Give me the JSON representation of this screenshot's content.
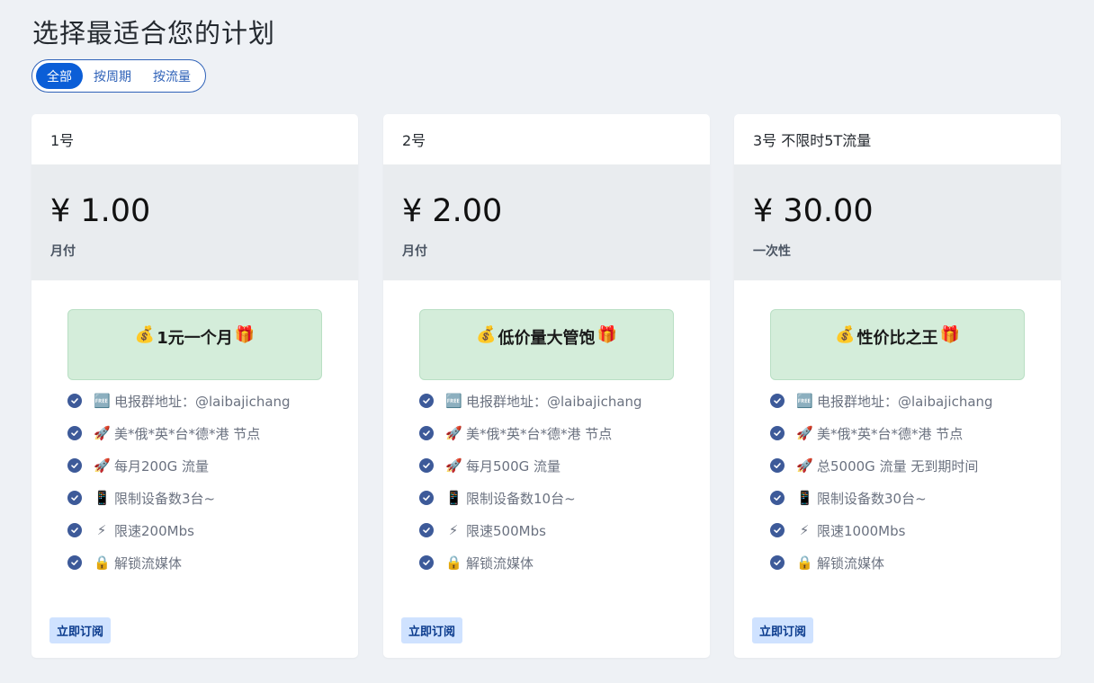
{
  "page": {
    "title": "选择最适合您的计划"
  },
  "filters": [
    {
      "label": "全部",
      "active": true
    },
    {
      "label": "按周期",
      "active": false
    },
    {
      "label": "按流量",
      "active": false
    }
  ],
  "colors": {
    "accent": "#0b5ed7",
    "promo_bg": "#d4edda",
    "price_bg": "#e9ecef",
    "check": "#3d5a99"
  },
  "plans": [
    {
      "name": "1号",
      "price": "¥ 1.00",
      "period": "月付",
      "promo": "1元一个月",
      "features": [
        {
          "icon": "free-icon",
          "glyph": "🆓",
          "text": "电报群地址：@laibajichang"
        },
        {
          "icon": "rocket-icon",
          "glyph": "🚀",
          "text": "美*俄*英*台*德*港 节点"
        },
        {
          "icon": "rocket-icon",
          "glyph": "🚀",
          "text": "每月200G 流量"
        },
        {
          "icon": "phone-icon",
          "glyph": "📱",
          "text": "限制设备数3台~"
        },
        {
          "icon": "lightning-icon",
          "glyph": "⚡",
          "text": "限速200Mbs"
        },
        {
          "icon": "lock-icon",
          "glyph": "🔒",
          "text": "解锁流媒体"
        }
      ],
      "cta": "立即订阅"
    },
    {
      "name": "2号",
      "price": "¥ 2.00",
      "period": "月付",
      "promo": "低价量大管饱",
      "features": [
        {
          "icon": "free-icon",
          "glyph": "🆓",
          "text": "电报群地址：@laibajichang"
        },
        {
          "icon": "rocket-icon",
          "glyph": "🚀",
          "text": "美*俄*英*台*德*港 节点"
        },
        {
          "icon": "rocket-icon",
          "glyph": "🚀",
          "text": "每月500G 流量"
        },
        {
          "icon": "phone-icon",
          "glyph": "📱",
          "text": "限制设备数10台~"
        },
        {
          "icon": "lightning-icon",
          "glyph": "⚡",
          "text": "限速500Mbs"
        },
        {
          "icon": "lock-icon",
          "glyph": "🔒",
          "text": "解锁流媒体"
        }
      ],
      "cta": "立即订阅"
    },
    {
      "name": "3号 不限时5T流量",
      "price": "¥ 30.00",
      "period": "一次性",
      "promo": "性价比之王",
      "features": [
        {
          "icon": "free-icon",
          "glyph": "🆓",
          "text": "电报群地址：@laibajichang"
        },
        {
          "icon": "rocket-icon",
          "glyph": "🚀",
          "text": "美*俄*英*台*德*港 节点"
        },
        {
          "icon": "rocket-icon",
          "glyph": "🚀",
          "text": "总5000G 流量 无到期时间"
        },
        {
          "icon": "phone-icon",
          "glyph": "📱",
          "text": "限制设备数30台~"
        },
        {
          "icon": "lightning-icon",
          "glyph": "⚡",
          "text": "限速1000Mbs"
        },
        {
          "icon": "lock-icon",
          "glyph": "🔒",
          "text": "解锁流媒体"
        }
      ],
      "cta": "立即订阅"
    }
  ]
}
